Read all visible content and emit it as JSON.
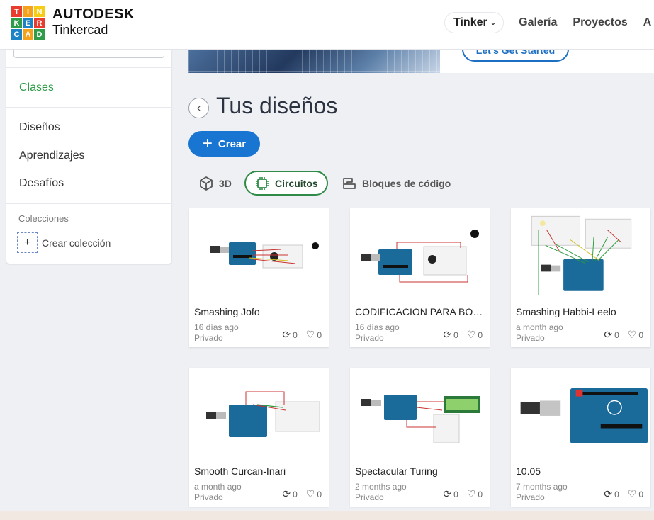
{
  "header": {
    "logo_letters": [
      "T",
      "I",
      "N",
      "K",
      "E",
      "R",
      "C",
      "A",
      "D"
    ],
    "logo_colors": [
      "#e83c2f",
      "#f4a11b",
      "#f7cc16",
      "#2f9c4a",
      "#1c84c6",
      "#e83c2f",
      "#1c84c6",
      "#f4a11b",
      "#2f9c4a"
    ],
    "brand_top": "AUTODESK",
    "brand_sub": "Tinkercad",
    "nav_pill": "Tinker",
    "nav_links": [
      "Galería",
      "Proyectos",
      "A"
    ]
  },
  "banner": {
    "button": "Let's Get Started"
  },
  "sidebar": {
    "clases": "Clases",
    "disenos": "Diseños",
    "aprendizajes": "Aprendizajes",
    "desafios": "Desafíos",
    "collections_heading": "Colecciones",
    "add_symbol": "+",
    "create_collection": "Crear colección"
  },
  "main": {
    "back_symbol": "‹",
    "title": "Tus diseños",
    "create_symbol": "+",
    "create_label": "Crear",
    "tabs": {
      "t3d": "3D",
      "circuitos": "Circuitos",
      "bloques": "Bloques de código"
    }
  },
  "cards": [
    {
      "title": "Smashing Jofo",
      "date": "16 días ago",
      "privacy": "Privado",
      "remixes": "0",
      "likes": "0"
    },
    {
      "title": "CODIFICACION PARA BOC...",
      "date": "16 días ago",
      "privacy": "Privado",
      "remixes": "0",
      "likes": "0"
    },
    {
      "title": "Smashing Habbi-Leelo",
      "date": "a month ago",
      "privacy": "Privado",
      "remixes": "0",
      "likes": "0"
    },
    {
      "title": "Smooth Curcan-Inari",
      "date": "a month ago",
      "privacy": "Privado",
      "remixes": "0",
      "likes": "0"
    },
    {
      "title": "Spectacular Turing",
      "date": "2 months ago",
      "privacy": "Privado",
      "remixes": "0",
      "likes": "0"
    },
    {
      "title": "10.05",
      "date": "7 months ago",
      "privacy": "Privado",
      "remixes": "0",
      "likes": "0"
    }
  ],
  "icons": {
    "remix": "⟳",
    "like": "♡",
    "chevron": "⌄"
  },
  "colors": {
    "accent_blue": "#1875d1",
    "accent_green": "#2d9b47",
    "arduino_blue": "#1a6a9a"
  }
}
